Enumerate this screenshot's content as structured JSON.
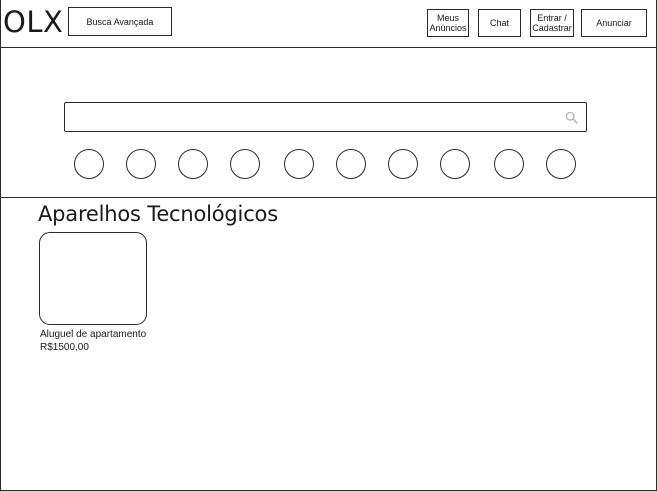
{
  "header": {
    "logo": "OLX",
    "advanced_search_label": "Busca Avançada",
    "my_ads_label": "Meus\nAnúncios",
    "chat_label": "Chat",
    "login_label": "Entrar /\nCadastrar",
    "post_ad_label": "Anunciar"
  },
  "search": {
    "value": "",
    "placeholder": "",
    "icon": "search-icon"
  },
  "categories": {
    "count_visible": 10
  },
  "section": {
    "title": "Aparelhos Tecnológicos"
  },
  "listings": [
    {
      "title": "Aluguel de apartamento",
      "price": "R$1500,00"
    }
  ],
  "colors": {
    "line": "#2b2b2b",
    "background": "#ffffff",
    "icon": "#b5b5b5"
  }
}
